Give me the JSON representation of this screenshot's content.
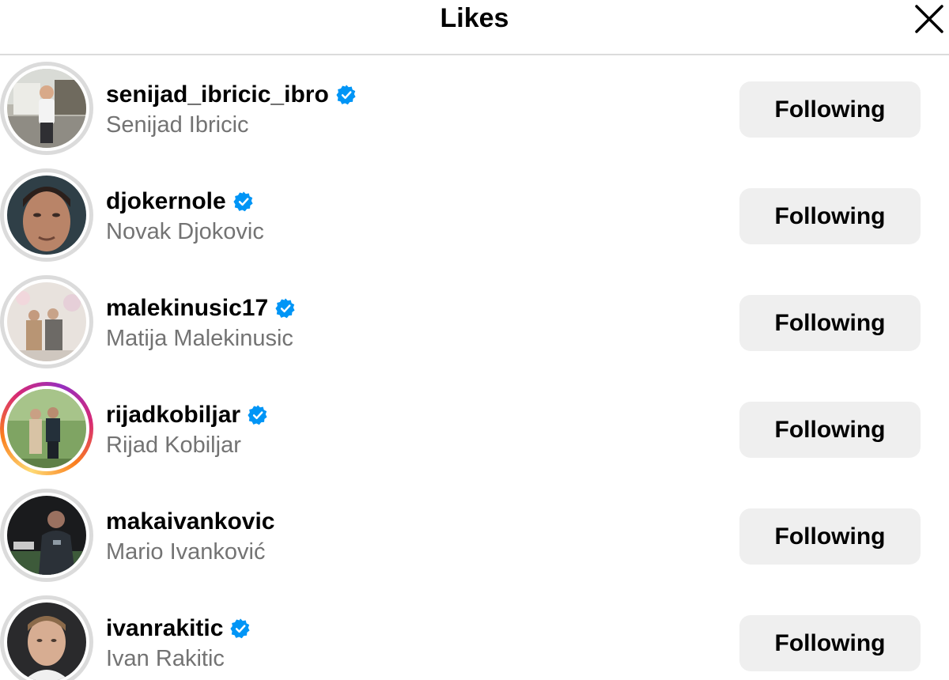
{
  "header": {
    "title": "Likes",
    "close_icon": "close-icon"
  },
  "accent": {
    "verified": "#0095f6",
    "button_bg": "#efefef",
    "secondary_text": "#737373"
  },
  "likes": [
    {
      "username": "senijad_ibricic_ibro",
      "full_name": "Senijad Ibricic",
      "verified": true,
      "story_ring": false,
      "button_label": "Following"
    },
    {
      "username": "djokernole",
      "full_name": "Novak Djokovic",
      "verified": true,
      "story_ring": false,
      "button_label": "Following"
    },
    {
      "username": "malekinusic17",
      "full_name": "Matija Malekinusic",
      "verified": true,
      "story_ring": false,
      "button_label": "Following"
    },
    {
      "username": "rijadkobiljar",
      "full_name": "Rijad Kobiljar",
      "verified": true,
      "story_ring": true,
      "button_label": "Following"
    },
    {
      "username": "makaivankovic",
      "full_name": "Mario Ivanković",
      "verified": false,
      "story_ring": false,
      "button_label": "Following"
    },
    {
      "username": "ivanrakitic",
      "full_name": "Ivan Rakitic",
      "verified": true,
      "story_ring": false,
      "button_label": "Following"
    }
  ]
}
